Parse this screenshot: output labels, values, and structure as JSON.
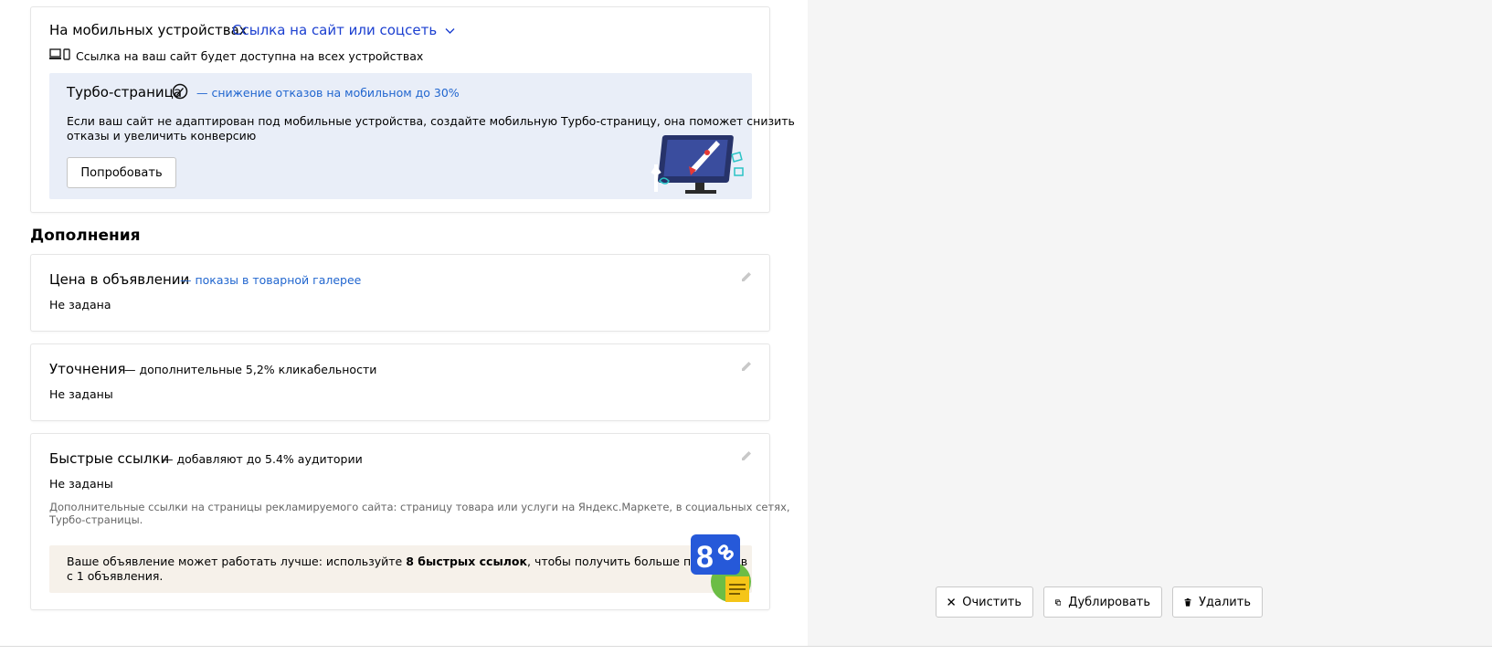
{
  "mobile": {
    "label": "На мобильных устройствах",
    "dropdown_value": "Ссылка на сайт или соцсеть",
    "note": "Ссылка на ваш сайт будет доступна на всех устройствах"
  },
  "turbo": {
    "title": "Турбо-страница",
    "subtitle": "— снижение отказов на мобильном до 30%",
    "text_line1": "Если ваш сайт не адаптирован под мобильные устройства, создайте мобильную Турбо-страницу, она поможет снизить",
    "text_line2": "отказы и увеличить конверсию",
    "button": "Попробовать"
  },
  "extras": {
    "heading": "Дополнения",
    "price": {
      "title": "Цена в объявлении",
      "subtitle": "— показы в товарной галерее",
      "value": "Не задана"
    },
    "callouts": {
      "title": "Уточнения",
      "subtitle": "— дополнительные 5,2% кликабельности",
      "value": "Не заданы"
    },
    "sitelinks": {
      "title": "Быстрые ссылки",
      "subtitle": "— добавляют до 5.4% аудитории",
      "value": "Не заданы",
      "desc_line1": "Дополнительные ссылки на страницы рекламируемого сайта: страницу товара или услуги на Яндекс.Маркете, в социальных сетях,",
      "desc_line2": "Турбо-страницы.",
      "promo_prefix": "Ваше объявление может работать лучше: используйте ",
      "promo_bold": "8 быстрых ссылок",
      "promo_suffix": ", чтобы получить больше переходов",
      "promo_line2": "с 1 объявления.",
      "badge_number": "8"
    }
  },
  "actions": {
    "clear": "Очистить",
    "duplicate": "Дублировать",
    "delete": "Удалить"
  },
  "colors": {
    "link": "#2166cf",
    "dropdown_link": "#1b3fd0",
    "turbo_bg": "#e9eef8",
    "promo_bg": "#f6f1ea",
    "panel_bg": "#f5f5f5"
  }
}
